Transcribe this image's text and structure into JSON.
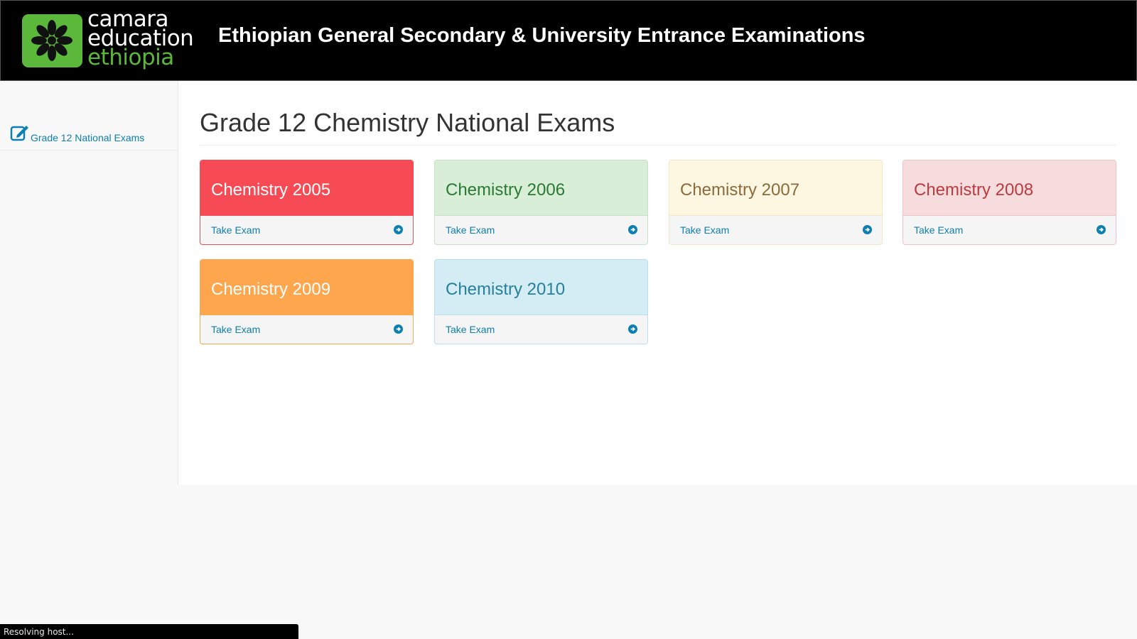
{
  "header": {
    "logo": {
      "line1": "camara",
      "line2": "education",
      "line3": "ethiopia"
    },
    "title": "Ethiopian General Secondary & University Entrance Examinations"
  },
  "sidebar": {
    "items": [
      {
        "label": "Grade 12 National Exams",
        "icon": "edit-icon"
      }
    ]
  },
  "main": {
    "title": "Grade 12 Chemistry National Exams",
    "cards": [
      {
        "title": "Chemistry 2005",
        "action": "Take Exam",
        "color": "#f64a55"
      },
      {
        "title": "Chemistry 2006",
        "action": "Take Exam",
        "color": "#d8eed6"
      },
      {
        "title": "Chemistry 2007",
        "action": "Take Exam",
        "color": "#fdf6e1"
      },
      {
        "title": "Chemistry 2008",
        "action": "Take Exam",
        "color": "#f6dcdd"
      },
      {
        "title": "Chemistry 2009",
        "action": "Take Exam",
        "color": "#fea64d"
      },
      {
        "title": "Chemistry 2010",
        "action": "Take Exam",
        "color": "#d4ecf4"
      }
    ]
  },
  "status_bar": {
    "text": "Resolving host..."
  }
}
